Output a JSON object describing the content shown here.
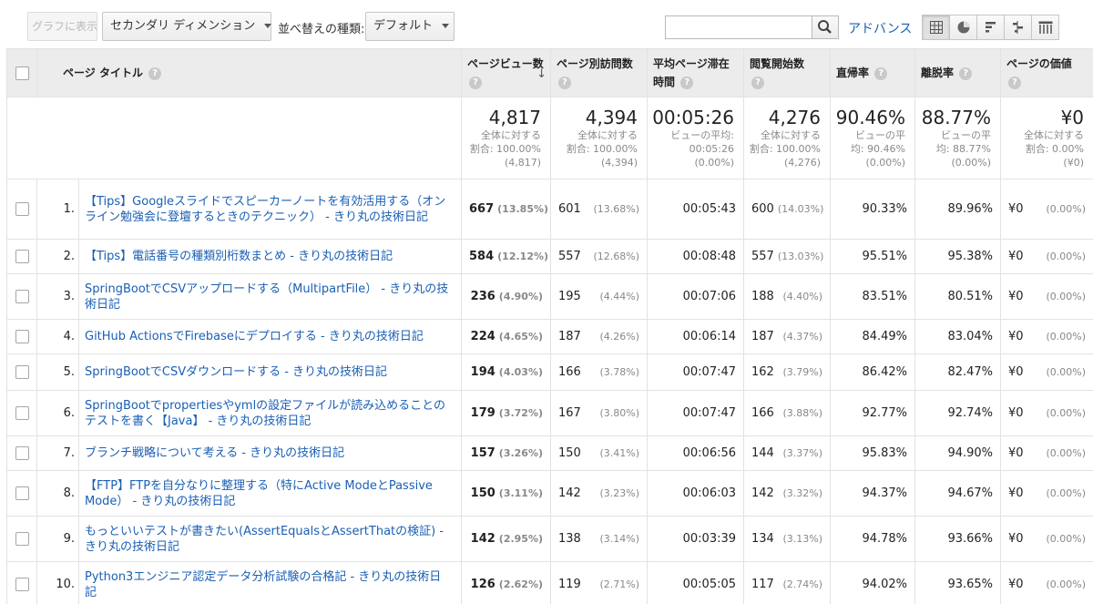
{
  "toolbar": {
    "chart_button": "グラフに表示",
    "secondary_dimension": "セカンダリ ディメンション",
    "sort_type_label": "並べ替えの種類:",
    "sort_type_value": "デフォルト",
    "search_value": "",
    "advanced_link": "アドバンス",
    "views": [
      "data-table-icon",
      "pie-chart-icon",
      "performance-icon",
      "comparison-icon",
      "pivot-icon"
    ]
  },
  "columns": {
    "page_title": "ページ タイトル",
    "pageviews": "ページビュー数",
    "unique_pageviews": "ページ別訪問数",
    "avg_time": "平均ページ滞在時間",
    "entrances": "閲覧開始数",
    "bounce_rate": "直帰率",
    "exit_rate": "離脱率",
    "page_value": "ページの価値"
  },
  "summary": {
    "pageviews": {
      "value": "4,817",
      "sub1": "全体に対する",
      "sub2": "割合: 100.00%",
      "sub3": "(4,817)"
    },
    "unique_pageviews": {
      "value": "4,394",
      "sub1": "全体に対する",
      "sub2": "割合: 100.00%",
      "sub3": "(4,394)"
    },
    "avg_time": {
      "value": "00:05:26",
      "sub1": "ビューの平均:",
      "sub2": "00:05:26",
      "sub3": "(0.00%)"
    },
    "entrances": {
      "value": "4,276",
      "sub1": "全体に対する",
      "sub2": "割合: 100.00%",
      "sub3": "(4,276)"
    },
    "bounce_rate": {
      "value": "90.46%",
      "sub1": "ビューの平",
      "sub2": "均: 90.46%",
      "sub3": "(0.00%)"
    },
    "exit_rate": {
      "value": "88.77%",
      "sub1": "ビューの平",
      "sub2": "均: 88.77%",
      "sub3": "(0.00%)"
    },
    "page_value": {
      "value": "¥0",
      "sub1": "全体に対する",
      "sub2": "割合: 0.00%",
      "sub3": "(¥0)"
    }
  },
  "rows": [
    {
      "idx": "1.",
      "title": "【Tips】Googleスライドでスピーカーノートを有効活用する（オンライン勉強会に登壇するときのテクニック） - きり丸の技術日記",
      "pv": "667",
      "pv_pct": "(13.85%)",
      "upv": "601",
      "upv_pct": "(13.68%)",
      "time": "00:05:43",
      "ent": "600",
      "ent_pct": "(14.03%)",
      "bounce": "90.33%",
      "exit": "89.96%",
      "val": "¥0",
      "val_pct": "(0.00%)"
    },
    {
      "idx": "2.",
      "title": "【Tips】電話番号の種類別桁数まとめ - きり丸の技術日記",
      "pv": "584",
      "pv_pct": "(12.12%)",
      "upv": "557",
      "upv_pct": "(12.68%)",
      "time": "00:08:48",
      "ent": "557",
      "ent_pct": "(13.03%)",
      "bounce": "95.51%",
      "exit": "95.38%",
      "val": "¥0",
      "val_pct": "(0.00%)"
    },
    {
      "idx": "3.",
      "title": "SpringBootでCSVアップロードする（MultipartFile） - きり丸の技術日記",
      "pv": "236",
      "pv_pct": "(4.90%)",
      "upv": "195",
      "upv_pct": "(4.44%)",
      "time": "00:07:06",
      "ent": "188",
      "ent_pct": "(4.40%)",
      "bounce": "83.51%",
      "exit": "80.51%",
      "val": "¥0",
      "val_pct": "(0.00%)"
    },
    {
      "idx": "4.",
      "title": "GitHub ActionsでFirebaseにデプロイする - きり丸の技術日記",
      "pv": "224",
      "pv_pct": "(4.65%)",
      "upv": "187",
      "upv_pct": "(4.26%)",
      "time": "00:06:14",
      "ent": "187",
      "ent_pct": "(4.37%)",
      "bounce": "84.49%",
      "exit": "83.04%",
      "val": "¥0",
      "val_pct": "(0.00%)"
    },
    {
      "idx": "5.",
      "title": "SpringBootでCSVダウンロードする - きり丸の技術日記",
      "pv": "194",
      "pv_pct": "(4.03%)",
      "upv": "166",
      "upv_pct": "(3.78%)",
      "time": "00:07:47",
      "ent": "162",
      "ent_pct": "(3.79%)",
      "bounce": "86.42%",
      "exit": "82.47%",
      "val": "¥0",
      "val_pct": "(0.00%)"
    },
    {
      "idx": "6.",
      "title": "SpringBootでpropertiesやymlの設定ファイルが読み込めることのテストを書く【Java】 - きり丸の技術日記",
      "pv": "179",
      "pv_pct": "(3.72%)",
      "upv": "167",
      "upv_pct": "(3.80%)",
      "time": "00:07:47",
      "ent": "166",
      "ent_pct": "(3.88%)",
      "bounce": "92.77%",
      "exit": "92.74%",
      "val": "¥0",
      "val_pct": "(0.00%)"
    },
    {
      "idx": "7.",
      "title": "ブランチ戦略について考える - きり丸の技術日記",
      "pv": "157",
      "pv_pct": "(3.26%)",
      "upv": "150",
      "upv_pct": "(3.41%)",
      "time": "00:06:56",
      "ent": "144",
      "ent_pct": "(3.37%)",
      "bounce": "95.83%",
      "exit": "94.90%",
      "val": "¥0",
      "val_pct": "(0.00%)"
    },
    {
      "idx": "8.",
      "title": "【FTP】FTPを自分なりに整理する（特にActive ModeとPassive Mode） - きり丸の技術日記",
      "pv": "150",
      "pv_pct": "(3.11%)",
      "upv": "142",
      "upv_pct": "(3.23%)",
      "time": "00:06:03",
      "ent": "142",
      "ent_pct": "(3.32%)",
      "bounce": "94.37%",
      "exit": "94.67%",
      "val": "¥0",
      "val_pct": "(0.00%)"
    },
    {
      "idx": "9.",
      "title": "もっといいテストが書きたい(AssertEqualsとAssertThatの検証) - きり丸の技術日記",
      "pv": "142",
      "pv_pct": "(2.95%)",
      "upv": "138",
      "upv_pct": "(3.14%)",
      "time": "00:03:39",
      "ent": "134",
      "ent_pct": "(3.13%)",
      "bounce": "94.78%",
      "exit": "93.66%",
      "val": "¥0",
      "val_pct": "(0.00%)"
    },
    {
      "idx": "10.",
      "title": "Python3エンジニア認定データ分析試験の合格記 - きり丸の技術日記",
      "pv": "126",
      "pv_pct": "(2.62%)",
      "upv": "119",
      "upv_pct": "(2.71%)",
      "time": "00:05:05",
      "ent": "117",
      "ent_pct": "(2.74%)",
      "bounce": "94.02%",
      "exit": "93.65%",
      "val": "¥0",
      "val_pct": "(0.00%)"
    }
  ]
}
